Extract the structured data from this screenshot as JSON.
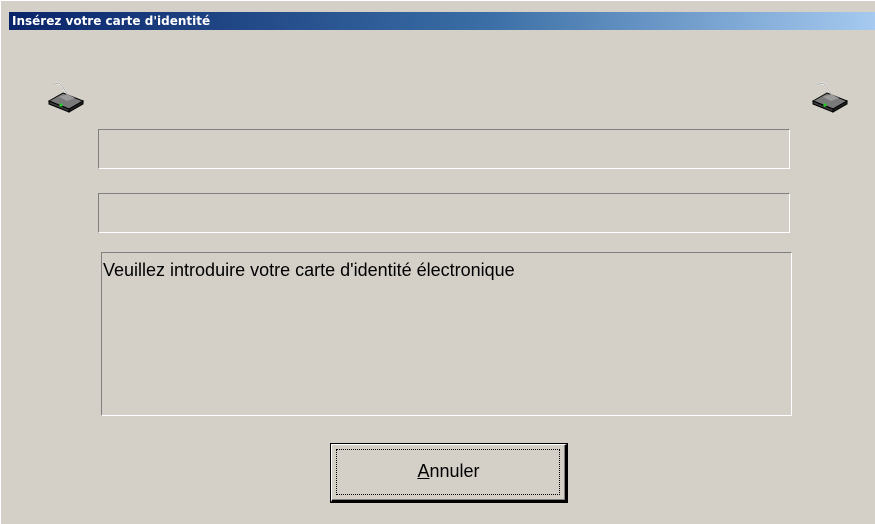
{
  "window": {
    "title": "Insérez votre carte d'identité"
  },
  "icons": {
    "left": "card-reader-icon",
    "right": "card-reader-icon"
  },
  "fields": {
    "field1_value": "",
    "field2_value": ""
  },
  "message": "Veuillez introduire votre carte d'identité électronique",
  "cancel_button": {
    "mnemonic": "A",
    "rest": "nnuler"
  },
  "colors": {
    "dialog_bg": "#d4d0c8",
    "title_start": "#0a246a",
    "title_end": "#a6caf0",
    "reader_led": "#22cc22"
  }
}
